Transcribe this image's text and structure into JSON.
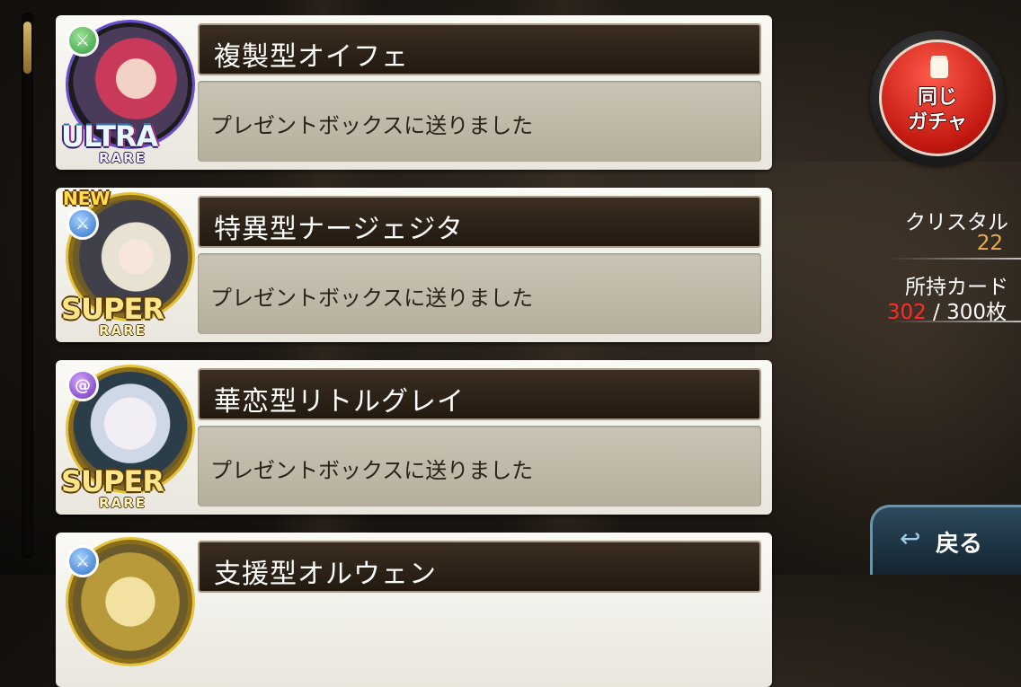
{
  "cards": [
    {
      "name": "複製型オイフェ",
      "message": "プレゼントボックスに送りました",
      "rarity_main": "ULTRA",
      "rarity_sub": "RARE",
      "new_tag": "",
      "attribute_icon": "sword-icon"
    },
    {
      "name": "特異型ナージェジタ",
      "message": "プレゼントボックスに送りました",
      "rarity_main": "SUPER",
      "rarity_sub": "RARE",
      "new_tag": "NEW",
      "attribute_icon": "sword-icon"
    },
    {
      "name": "華恋型リトルグレイ",
      "message": "プレゼントボックスに送りました",
      "rarity_main": "SUPER",
      "rarity_sub": "RARE",
      "new_tag": "",
      "attribute_icon": "spiral-icon"
    },
    {
      "name": "支援型オルウェン",
      "message": "",
      "rarity_main": "",
      "rarity_sub": "",
      "new_tag": "",
      "attribute_icon": "sword-icon"
    }
  ],
  "gacha_button": {
    "label_line1": "同じ",
    "label_line2": "ガチャ"
  },
  "stats": {
    "crystal_label": "クリスタル",
    "crystal_value": "22",
    "cards_label": "所持カード",
    "cards_current": "302",
    "cards_separator": " / ",
    "cards_max": "300枚"
  },
  "back_button": {
    "label": "戻る"
  },
  "colors": {
    "crystal_value": "#e8b04a",
    "cards_over": "#ff2a2a",
    "gacha_red": "#c21810"
  }
}
